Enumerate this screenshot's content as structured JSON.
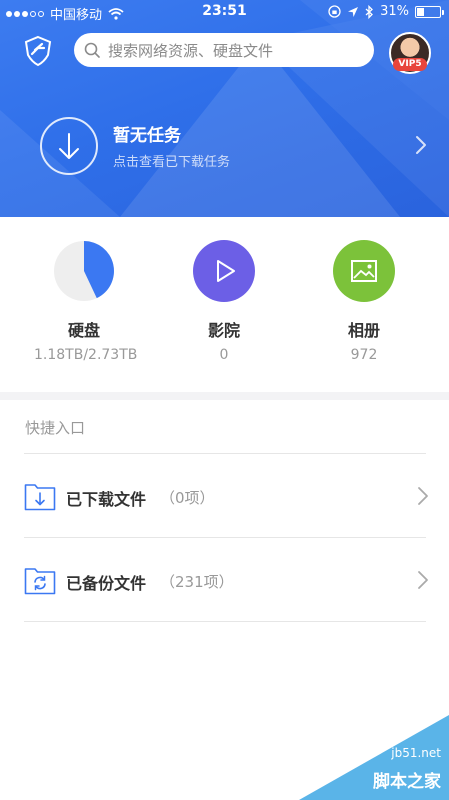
{
  "status_bar": {
    "carrier": "中国移动",
    "time": "23:51",
    "battery": "31%",
    "battery_level": 0.31
  },
  "search": {
    "placeholder": "搜索网络资源、硬盘文件"
  },
  "avatar": {
    "badge": "VIP5"
  },
  "task": {
    "title": "暂无任务",
    "subtitle": "点击查看已下载任务"
  },
  "categories": [
    {
      "label": "硬盘",
      "value": "1.18TB/2.73TB",
      "icon": "pie-usage-icon",
      "color": "#3b78f2",
      "usage": 0.43
    },
    {
      "label": "影院",
      "value": "0",
      "icon": "play-icon",
      "color": "#6c5fe6"
    },
    {
      "label": "相册",
      "value": "972",
      "icon": "picture-icon",
      "color": "#7cc23a"
    }
  ],
  "quick_access": {
    "title": "快捷入口",
    "items": [
      {
        "name": "已下载文件",
        "count": "（0项）",
        "icon": "download-folder-icon"
      },
      {
        "name": "已备份文件",
        "count": "（231项）",
        "icon": "backup-folder-icon"
      }
    ]
  },
  "watermark": {
    "site": "jb51.net",
    "name": "脚本之家"
  },
  "colors": {
    "brand_blue": "#2f6fe9",
    "icon_blue": "#3b78f2"
  }
}
